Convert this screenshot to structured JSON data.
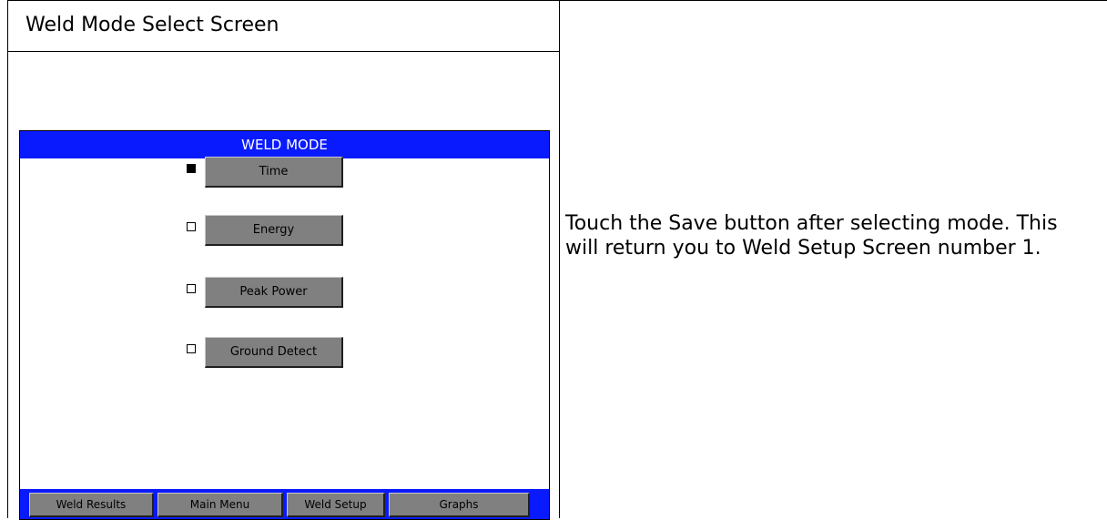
{
  "page_title": "Weld Mode Select Screen",
  "screen": {
    "header": "WELD MODE",
    "header_color": "#0a1aff",
    "modes": [
      {
        "label": "Time",
        "selected": true
      },
      {
        "label": "Energy",
        "selected": false
      },
      {
        "label": "Peak Power",
        "selected": false
      },
      {
        "label": "Ground Detect",
        "selected": false
      }
    ],
    "nav": [
      {
        "label": "Weld Results"
      },
      {
        "label": "Main Menu"
      },
      {
        "label": "Weld Setup"
      },
      {
        "label": "Graphs"
      }
    ]
  },
  "description": "Touch the Save button after selecting mode. This will return you to Weld Setup Screen number 1."
}
